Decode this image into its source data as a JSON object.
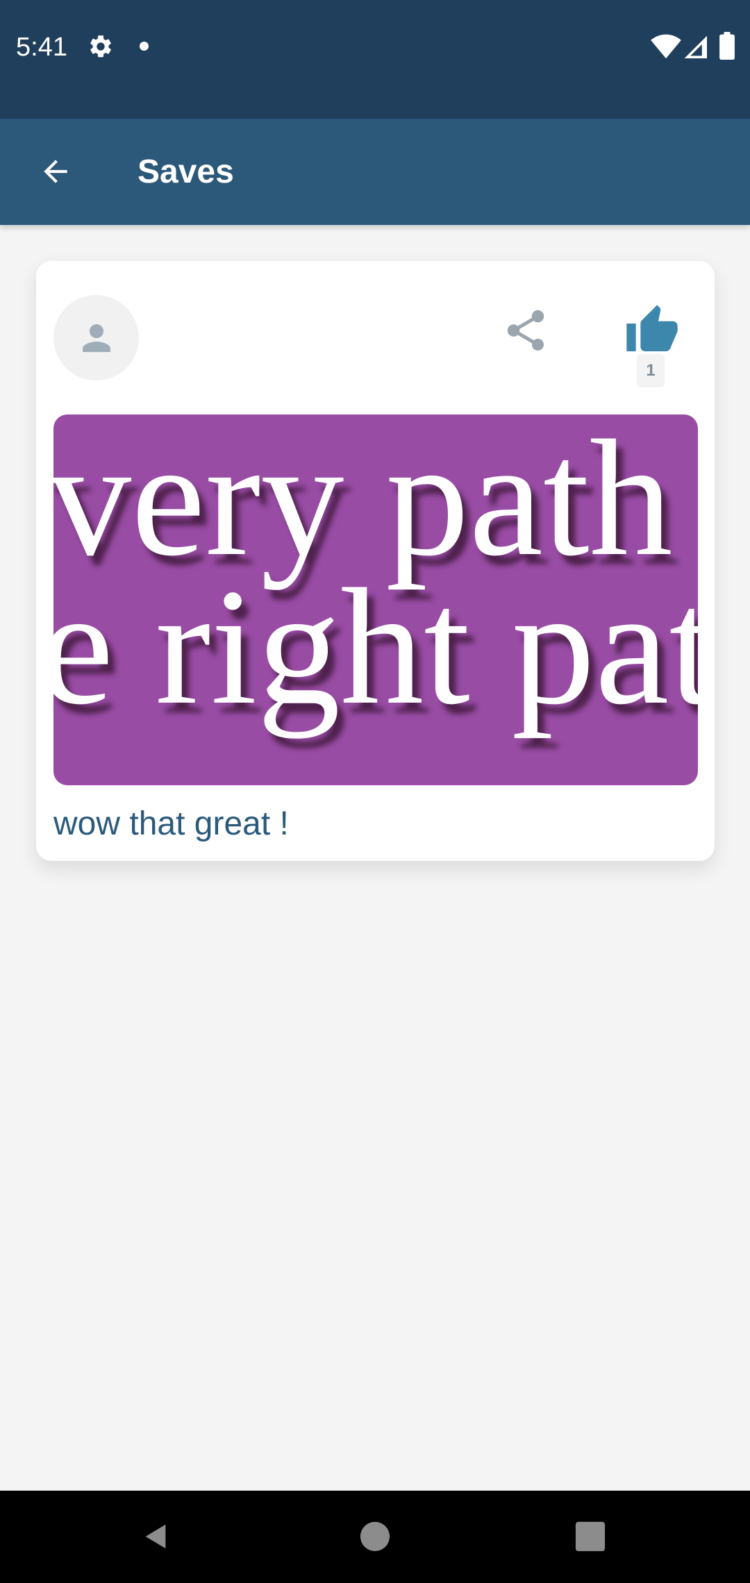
{
  "status_bar": {
    "time": "5:41",
    "icons": [
      "settings-icon",
      "notification-dot-icon",
      "wifi-icon",
      "signal-icon",
      "battery-icon"
    ]
  },
  "app_bar": {
    "title": "Saves",
    "back_icon": "arrow-back-icon"
  },
  "post": {
    "avatar_icon": "person-icon",
    "share_icon": "share-icon",
    "like_icon": "thumbs-up-icon",
    "like_count": "1",
    "image_text_line1": "very path",
    "image_text_line2": "e right pat",
    "caption": "wow that great !"
  },
  "nav_bar": {
    "buttons": [
      "back-triangle-icon",
      "home-circle-icon",
      "recents-square-icon"
    ]
  },
  "colors": {
    "status_bar": "#203f5c",
    "app_bar": "#2c5879",
    "background": "#f4f4f4",
    "card": "#ffffff",
    "image_background": "#984ca4",
    "caption": "#2b5a7b",
    "like_icon": "#3d87ad",
    "share_icon": "#9aa5ad"
  }
}
